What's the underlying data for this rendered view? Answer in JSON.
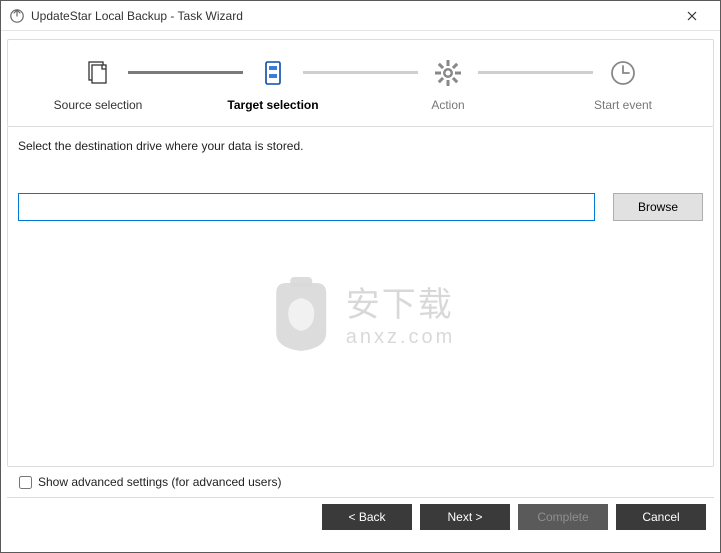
{
  "window": {
    "title": "UpdateStar Local Backup - Task Wizard"
  },
  "steps": {
    "source": {
      "label": "Source selection"
    },
    "target": {
      "label": "Target selection"
    },
    "action": {
      "label": "Action"
    },
    "start": {
      "label": "Start event"
    }
  },
  "instruction": "Select the destination drive where your data is stored.",
  "path_input": {
    "value": "",
    "placeholder": ""
  },
  "buttons": {
    "browse": "Browse",
    "back": "< Back",
    "next": "Next >",
    "complete": "Complete",
    "cancel": "Cancel"
  },
  "advanced": {
    "label": "Show advanced settings (for advanced users)",
    "checked": false
  },
  "watermark": {
    "line1": "安下载",
    "line2": "anxz.com"
  }
}
